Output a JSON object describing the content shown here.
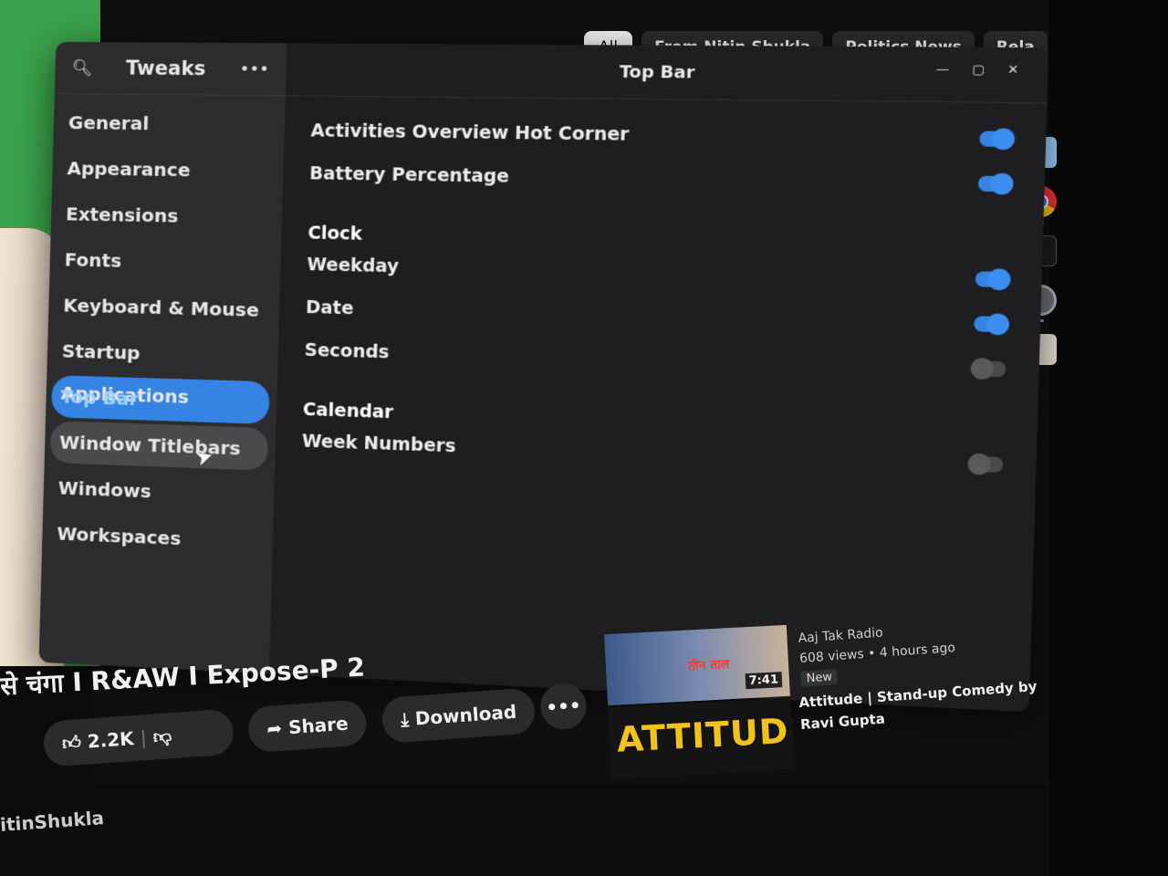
{
  "chips": [
    "All",
    "From Nitin Shukla",
    "Politics News",
    "Rela"
  ],
  "tweaks": {
    "title": "Tweaks",
    "panel_title": "Top Bar",
    "sidebar": [
      {
        "label": "General"
      },
      {
        "label": "Appearance"
      },
      {
        "label": "Extensions"
      },
      {
        "label": "Fonts"
      },
      {
        "label": "Keyboard & Mouse"
      },
      {
        "label": "Startup Applications"
      },
      {
        "label": "Top Bar"
      },
      {
        "label": "Window Titlebars"
      },
      {
        "label": "Windows"
      },
      {
        "label": "Workspaces"
      }
    ],
    "settings": {
      "hot_corner": {
        "label": "Activities Overview Hot Corner",
        "on": true
      },
      "battery": {
        "label": "Battery Percentage",
        "on": true
      },
      "clock_section": "Clock",
      "weekday": {
        "label": "Weekday",
        "on": true
      },
      "date": {
        "label": "Date",
        "on": true
      },
      "seconds": {
        "label": "Seconds",
        "on": false
      },
      "calendar_section": "Calendar",
      "week_numbers": {
        "label": "Week Numbers",
        "on": false
      }
    }
  },
  "video": {
    "title": "से चंगा I R&AW I Expose-P 2",
    "likes": "2.2K",
    "share": "Share",
    "download": "Download",
    "channel": "itinShukla"
  },
  "recommendations": [
    {
      "channel": "Aaj Tak Radio",
      "views": "608 views",
      "age": "• 4 hours ago",
      "badge": "New",
      "duration": "7:41",
      "thumb_text": "तीन ताल"
    },
    {
      "title": "Attitude | Stand-up Comedy by",
      "channel": "Ravi Gupta",
      "thumb_text": "ATTITUDE"
    }
  ],
  "colors": {
    "accent": "#3584e4",
    "window_bg": "#1e1e20",
    "sidebar_bg": "#2c2c2e",
    "green_screen": "#3aa24a"
  }
}
